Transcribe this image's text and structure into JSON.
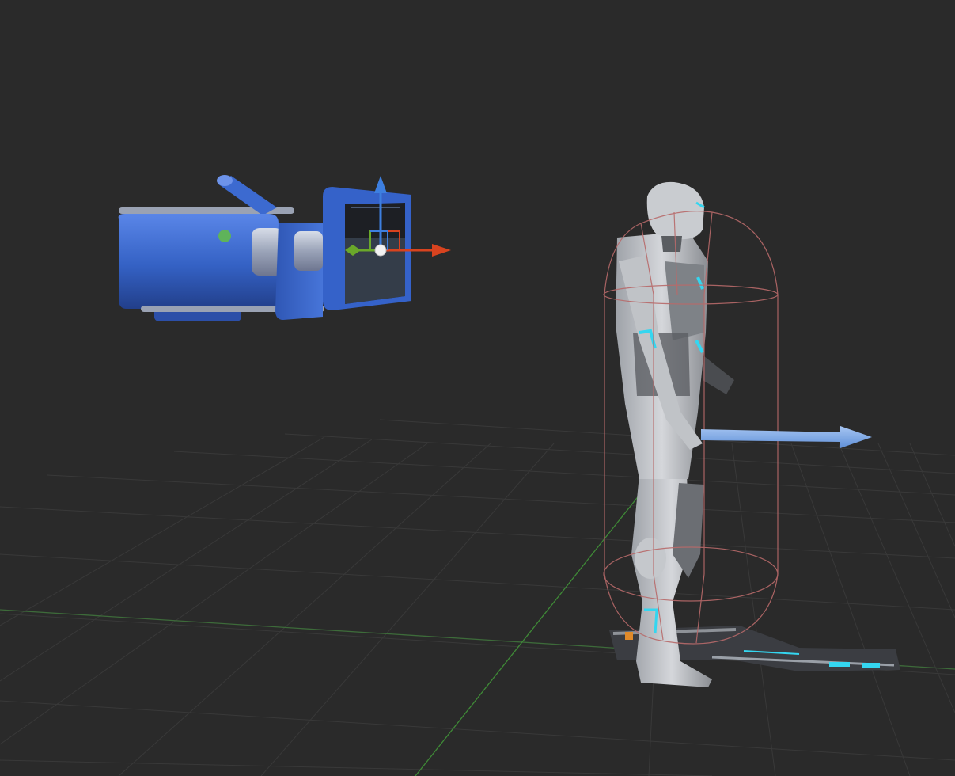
{
  "viewport": {
    "background_color": "#2a2a2a",
    "grid": {
      "shown": true,
      "line_color": "#3a3a3a",
      "x_axis_color": "#3d6b3a",
      "z_axis_color": "#3f8a37"
    }
  },
  "scene_objects": [
    {
      "name": "camera",
      "icon": "camera-icon",
      "color": "#3a66c9",
      "selected": true,
      "gizmo": {
        "type": "translate",
        "axes": [
          "x",
          "y",
          "z"
        ],
        "x_color": "#d8431f",
        "y_color": "#3d7fe0",
        "z_color": "#6aa82a"
      }
    },
    {
      "name": "armored-character",
      "color": "#b9bcc1",
      "accent_color": "#34d6f0",
      "collision_capsule": {
        "shown": true,
        "color": "#b86a6a"
      },
      "forward_arrow": {
        "shown": true,
        "color": "#86aee8"
      },
      "weapon": {
        "shown": true
      }
    }
  ]
}
